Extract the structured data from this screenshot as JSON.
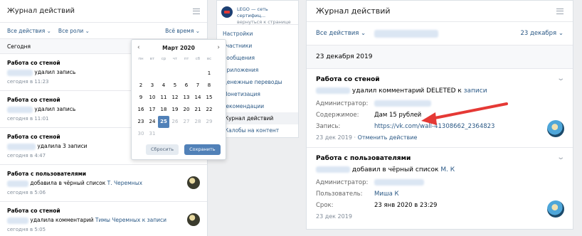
{
  "left": {
    "title": "Журнал действий",
    "filters": {
      "actions": "Все действия ⌄",
      "roles": "Все роли ⌄",
      "time": "Всё время ⌄"
    },
    "today": "Сегодня",
    "entries": [
      {
        "title": "Работа со стеной",
        "desc": " удалил запись",
        "target": "",
        "time": "сегодня в 11:23"
      },
      {
        "title": "Работа со стеной",
        "desc": " удалил запись",
        "target": "",
        "time": "сегодня в 11:01"
      },
      {
        "title": "Работа со стеной",
        "desc": " удалила 3 записи",
        "target": "",
        "time": "сегодня в 4:47"
      },
      {
        "title": "Работа с пользователями",
        "desc": " добавила в чёрный список ",
        "target": "Т. Черемных",
        "time": "сегодня в 5:06"
      },
      {
        "title": "Работа со стеной",
        "desc": " удалила комментарий ",
        "target": "Тимы Черемных к записи",
        "time": "сегодня в 5:05"
      }
    ]
  },
  "calendar": {
    "month": "Март 2020",
    "prev": "‹",
    "next": "›",
    "weekdays": [
      "пн",
      "вт",
      "ср",
      "чт",
      "пт",
      "сб",
      "вс"
    ],
    "days": [
      [
        "",
        "",
        "",
        "",
        "",
        "",
        "1"
      ],
      [
        "2",
        "3",
        "4",
        "5",
        "6",
        "7",
        "8"
      ],
      [
        "9",
        "10",
        "11",
        "12",
        "13",
        "14",
        "15"
      ],
      [
        "16",
        "17",
        "18",
        "19",
        "20",
        "21",
        "22"
      ],
      [
        "23",
        "24",
        "25",
        "26",
        "27",
        "28",
        "29"
      ],
      [
        "30",
        "31",
        "",
        "",
        "",
        "",
        ""
      ]
    ],
    "selected": "25",
    "reset": "Сбросить",
    "save": "Сохранить"
  },
  "middle": {
    "community": "LEGO — сеть сертифиц...",
    "back": "вернуться к странице",
    "nav": [
      "Настройки",
      "Участники",
      "Сообщения",
      "Приложения",
      "Денежные переводы",
      "Монетизация",
      "Рекомендации",
      "Журнал действий",
      "Жалобы на контент"
    ],
    "active": "Журнал действий"
  },
  "right": {
    "title": "Журнал действий",
    "filter_actions": "Все действия ⌄",
    "filter_date": "23 декабря ⌄",
    "date_band": "23 декабря 2019",
    "card1": {
      "title": "Работа со стеной",
      "action": "удалил комментарий DELETED к ",
      "action_link": "записи",
      "admin_label": "Администратор:",
      "content_label": "Содержимое:",
      "content_value": "Дам 15 рублей",
      "post_label": "Запись:",
      "post_link": "https://vk.com/wall-41308662_2364823",
      "date": "23 дек 2019",
      "sep": "·",
      "cancel": "Отменить действие"
    },
    "card2": {
      "title": "Работа с пользователями",
      "action": "добавил в чёрный список ",
      "action_link": "М. К",
      "admin_label": "Администратор:",
      "user_label": "Пользователь:",
      "user_value": "Миша К",
      "term_label": "Срок:",
      "term_value": "23 янв 2020 в 23:29",
      "date": "23 дек 2019"
    }
  },
  "colors": {
    "accent": "#5181b8",
    "link": "#2a5885",
    "arrow": "#e53935"
  }
}
